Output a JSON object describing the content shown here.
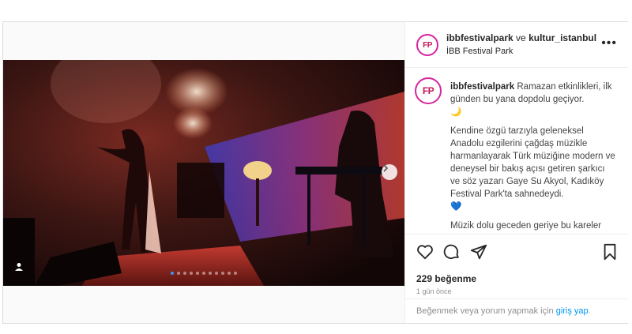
{
  "header": {
    "account": "ibbfestivalpark",
    "connector": "ve",
    "collaborator": "kultur_istanbul",
    "location": "İBB Festival Park",
    "more_icon": "more-horizontal-icon"
  },
  "caption": {
    "username": "ibbfestivalpark",
    "line1": "Ramazan etkinlikleri, ilk günden bu yana dopdolu geçiyor.",
    "emoji1": "🌙",
    "paragraph2": "Kendine özgü tarzıyla geleneksel Anadolu ezgilerini çağdaş müzikle harmanlayarak Türk müziğine modern ve deneysel bir bakış açısı getiren şarkıcı ve söz yazarı Gaye Su Akyol, Kadıköy Festival Park'ta sahnedeydi.",
    "emoji2": "💙",
    "paragraph3": "Müzik dolu geceden geriye bu kareler"
  },
  "avatar_text": "FP",
  "carousel": {
    "slide_count": 11,
    "active_index": 0
  },
  "stats": {
    "likes": "229 beğenme",
    "time": "1 gün önce"
  },
  "login": {
    "prefix": "Beğenmek veya yorum yapmak için",
    "link": "giriş yap",
    "suffix": "."
  },
  "colors": {
    "link": "#0095f6",
    "active_dot": "#3897f0"
  }
}
